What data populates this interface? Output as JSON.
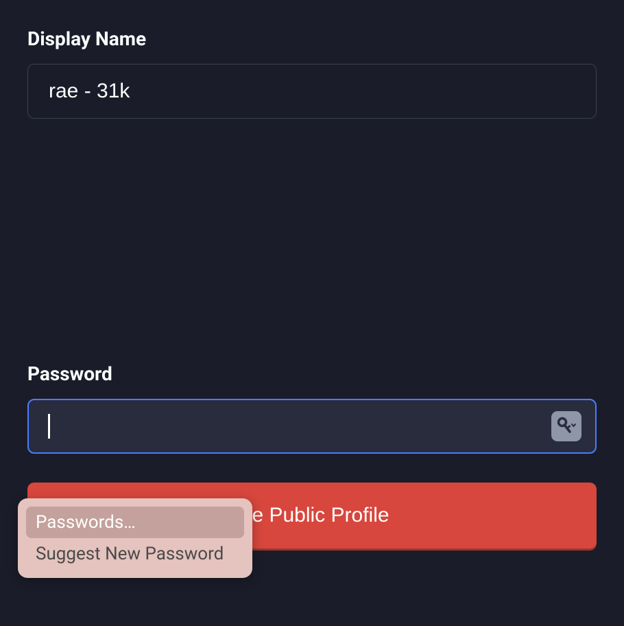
{
  "displayName": {
    "label": "Display Name",
    "value": "rae - 31k"
  },
  "password": {
    "label": "Password",
    "value": ""
  },
  "submitButton": {
    "label": "ate Public Profile"
  },
  "autofillMenu": {
    "items": [
      {
        "label": "Passwords…"
      },
      {
        "label": "Suggest New Password"
      }
    ]
  }
}
